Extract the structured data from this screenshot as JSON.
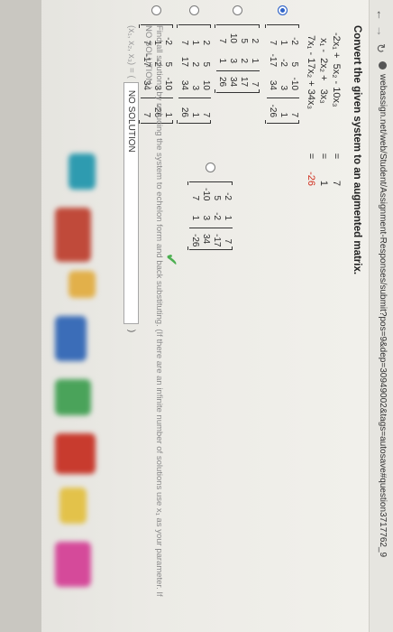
{
  "browser": {
    "url": "webassign.net/web/Student/Assignment-Responses/submit?pos=9&dep=30949002&tags=autosave#question3717762_9"
  },
  "question": {
    "prompt": "Convert the given system to an augmented matrix.",
    "system": [
      {
        "lhs": "-2x₁ +  5x₂ - 10x₃",
        "eq": "=",
        "rhs": "7",
        "highlight": false
      },
      {
        "lhs": "  x₁ -  2x₂ +   3x₃",
        "eq": "=",
        "rhs": "1",
        "highlight": false
      },
      {
        "lhs": " 7x₁ - 17x₂ + 34x₃",
        "eq": "=",
        "rhs": "-26",
        "highlight": true
      }
    ],
    "choices": [
      {
        "selected": true,
        "rows": [
          [
            "-2",
            "5",
            "-10",
            "7"
          ],
          [
            "1",
            "-2",
            "3",
            "1"
          ],
          [
            "7",
            "-17",
            "34",
            "-26"
          ]
        ]
      },
      {
        "selected": false,
        "rows": [
          [
            "2",
            "1",
            "7"
          ],
          [
            "5",
            "2",
            "17"
          ],
          [
            "10",
            "3",
            "34"
          ],
          [
            "7",
            "1",
            "26"
          ]
        ]
      },
      {
        "selected": false,
        "rows": [
          [
            "2",
            "5",
            "10",
            "7"
          ],
          [
            "1",
            "2",
            "3",
            "1"
          ],
          [
            "7",
            "17",
            "34",
            "26"
          ]
        ]
      },
      {
        "selected": false,
        "rows": [
          [
            "-2",
            "5",
            "-10",
            "1"
          ],
          [
            "1",
            "-2",
            "3",
            "-26"
          ],
          [
            "7",
            "-17",
            "34",
            "7"
          ]
        ]
      },
      {
        "selected": false,
        "rows": [
          [
            "-2",
            "1",
            "7"
          ],
          [
            "5",
            "-2",
            "-17"
          ],
          [
            "-10",
            "3",
            "34"
          ],
          [
            "7",
            "1",
            "-26"
          ]
        ]
      }
    ],
    "correct_mark": "✔",
    "subquestion": "Find all solutions by reducing the system to echelon form and back substituting. (If there are an infinite number of solutions use x₁ as your parameter. If",
    "subquestion_note": "NO SOLUTION.)",
    "answer_prefix": "(x₁, x₂, x₃) = (",
    "answer_value": "NO SOLUTION",
    "answer_suffix": ")"
  }
}
